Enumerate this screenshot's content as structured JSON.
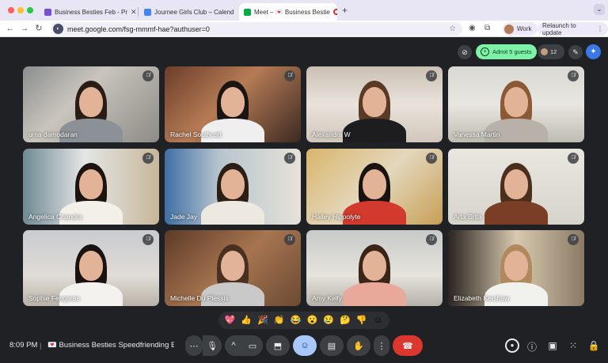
{
  "browser": {
    "tabs": [
      {
        "label": "Business Besties Feb - Pr",
        "active": false,
        "favicon_color": "#7b4dd6"
      },
      {
        "label": "Journee Girls Club – Calend",
        "active": false,
        "favicon_color": "#4285f4"
      },
      {
        "label": "Meet – 💌 Business Bestie",
        "active": true,
        "favicon_color": "#00ac47"
      }
    ],
    "new_tab": "+",
    "tab_menu": "⌄",
    "url": "meet.google.com/fsg-mmmf-hae?authuser=0",
    "profile_label": "Work",
    "relaunch_label": "Relaunch to update"
  },
  "meet": {
    "admit_label": "Admit 5 guests",
    "participant_count": "12",
    "participants": [
      {
        "name": "uma damodaran"
      },
      {
        "name": "Rachel Southcott"
      },
      {
        "name": "Alexandra W"
      },
      {
        "name": "Vanessa Martin"
      },
      {
        "name": "Angelica Chandra"
      },
      {
        "name": "Jade Jay"
      },
      {
        "name": "Hailey Hippolyte"
      },
      {
        "name": "Arta Brita"
      },
      {
        "name": "Sophie Fengaras"
      },
      {
        "name": "Michelle Du Plessis"
      },
      {
        "name": "Amy Kelly"
      },
      {
        "name": "Elizabeth Kershaw"
      }
    ],
    "reactions": [
      "💖",
      "👍",
      "🎉",
      "👏",
      "😂",
      "😮",
      "😢",
      "🤔",
      "👎",
      "☺"
    ],
    "clock": "8:09 PM",
    "meeting_title": "💌 Business Besties Speedfriending Ev..."
  },
  "colors": {
    "meet_bg": "#202124",
    "admit_green": "#7ef3a7",
    "end_call_red": "#dc362e",
    "active_button": "#a8c7fa"
  }
}
